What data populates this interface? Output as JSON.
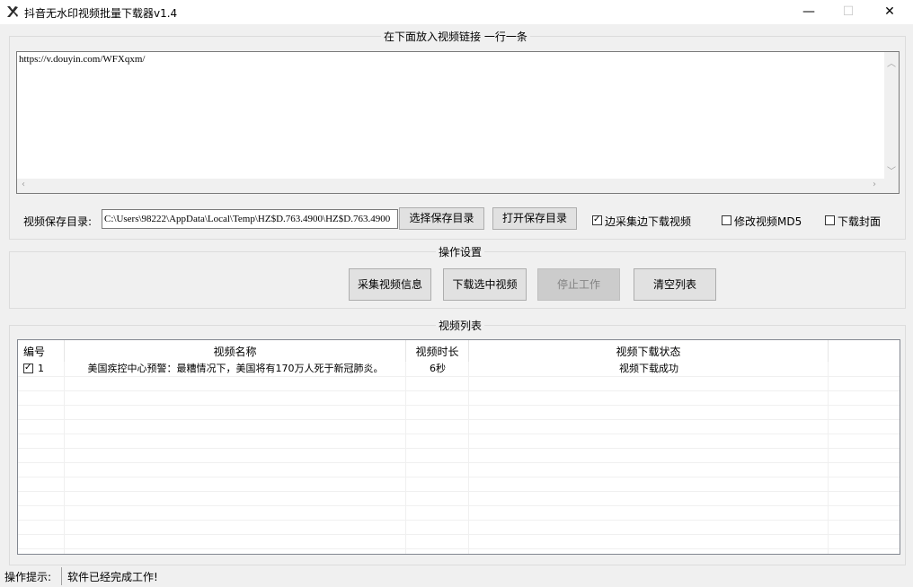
{
  "window": {
    "title": "抖音无水印视频批量下载器v1.4",
    "minimize": "—",
    "maximize": "☐",
    "close": "✕"
  },
  "links_group": {
    "title": "在下面放入视频链接  一行一条",
    "content": "https://v.douyin.com/WFXqxm/"
  },
  "save_dir": {
    "label": "视频保存目录:",
    "path": "C:\\Users\\98222\\AppData\\Local\\Temp\\HZ$D.763.4900\\HZ$D.763.4900",
    "choose_button": "选择保存目录",
    "open_button": "打开保存目录"
  },
  "options": [
    {
      "label": "边采集边下载视频",
      "checked": true
    },
    {
      "label": "修改视频MD5",
      "checked": false
    },
    {
      "label": "下载封面",
      "checked": false
    }
  ],
  "operations": {
    "title": "操作设置",
    "buttons": [
      {
        "label": "采集视频信息",
        "enabled": true
      },
      {
        "label": "下载选中视频",
        "enabled": true
      },
      {
        "label": "停止工作",
        "enabled": false
      },
      {
        "label": "清空列表",
        "enabled": true
      }
    ]
  },
  "video_list": {
    "title": "视频列表",
    "columns": [
      "编号",
      "视频名称",
      "视频时长",
      "视频下载状态"
    ],
    "rows": [
      {
        "checked": true,
        "id": "1",
        "name": "美国疾控中心预警：最糟情况下，美国将有170万人死于新冠肺炎。",
        "duration": "6秒",
        "status": "视频下载成功"
      }
    ]
  },
  "status": {
    "label": "操作提示:",
    "message": "软件已经完成工作!"
  }
}
